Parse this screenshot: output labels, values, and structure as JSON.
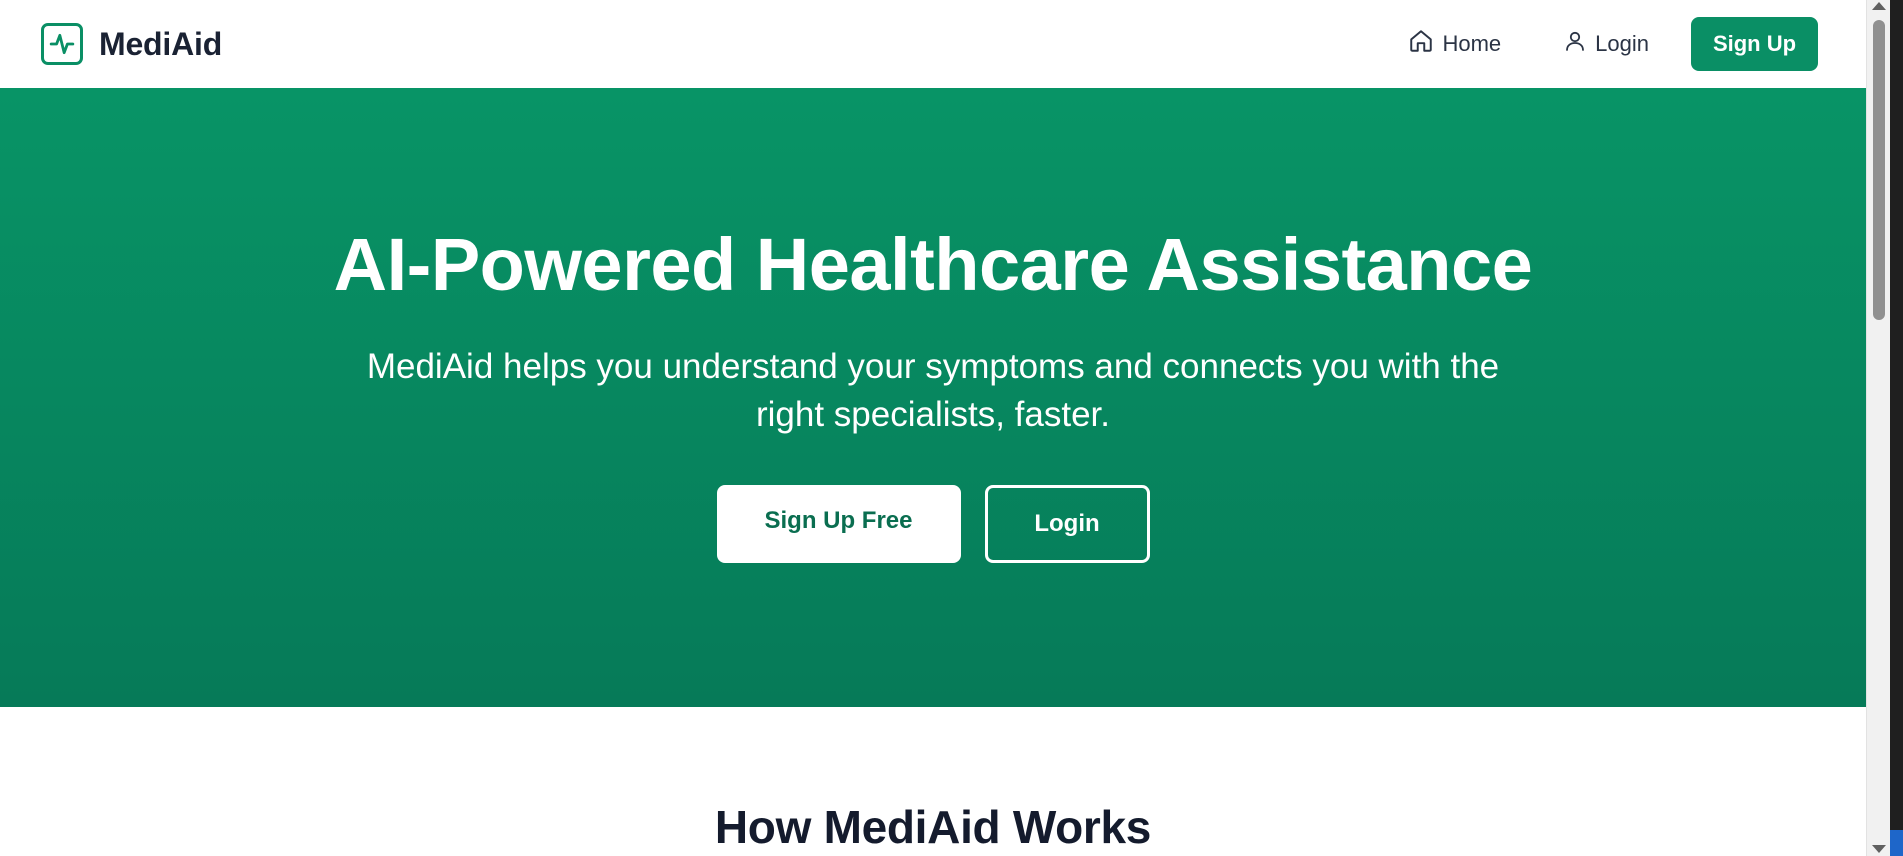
{
  "brand": {
    "name": "MediAid",
    "logo_icon": "activity-pulse-icon",
    "accent_color": "#0a8f65"
  },
  "nav": {
    "home_label": "Home",
    "home_icon": "home-icon",
    "login_label": "Login",
    "login_icon": "user-icon",
    "signup_label": "Sign Up"
  },
  "hero": {
    "title": "AI-Powered Healthcare Assistance",
    "subtitle": "MediAid helps you understand your symptoms and connects you with the right specialists, faster.",
    "primary_button": "Sign Up Free",
    "secondary_button": "Login",
    "gradient_top": "#089466",
    "gradient_bottom": "#067a58"
  },
  "sections": {
    "how_it_works_title": "How MediAid Works"
  }
}
